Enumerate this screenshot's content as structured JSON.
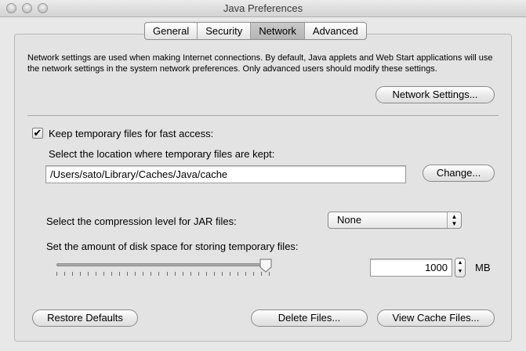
{
  "window": {
    "title": "Java Preferences"
  },
  "tabs": [
    {
      "label": "General"
    },
    {
      "label": "Security"
    },
    {
      "label": "Network"
    },
    {
      "label": "Advanced"
    }
  ],
  "active_tab": "Network",
  "network": {
    "description": "Network settings are used when making Internet connections.  By default, Java applets and Web Start applications will use the network settings in the system network preferences.  Only advanced users should modify these settings.",
    "settings_button": "Network Settings..."
  },
  "temp_files": {
    "checkbox_label": "Keep temporary files for fast access:",
    "checked": true,
    "location_label": "Select the location where temporary files are kept:",
    "location_value": "/Users/sato/Library/Caches/Java/cache",
    "change_button": "Change...",
    "compression_label": "Select the compression level for JAR files:",
    "compression_value": "None",
    "disk_space_label": "Set the amount of disk space for storing temporary files:",
    "disk_space_value": "1000",
    "disk_space_unit": "MB",
    "slider_fraction": 0.98
  },
  "buttons": {
    "restore_defaults": "Restore Defaults",
    "delete_files": "Delete Files...",
    "view_cache": "View Cache Files..."
  },
  "icons": {
    "close": "close-icon",
    "minimize": "minimize-icon",
    "zoom": "zoom-icon",
    "checkmark": "checkmark-icon",
    "select_arrows": "updown-arrows-icon",
    "stepper_arrows": "stepper-arrows-icon"
  }
}
